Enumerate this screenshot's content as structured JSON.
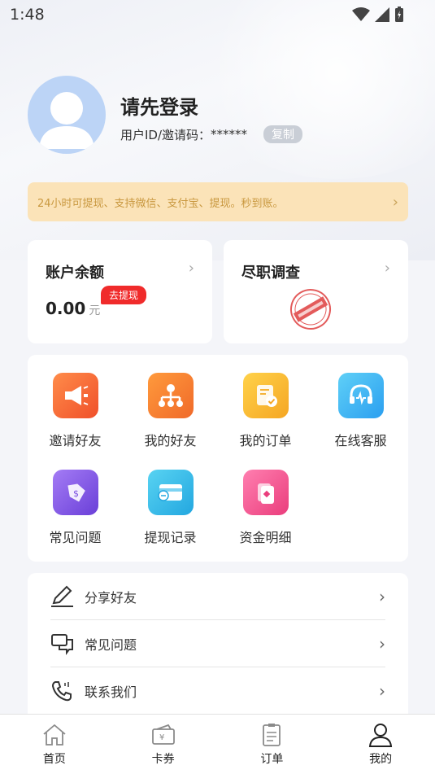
{
  "status_bar": {
    "time": "1:48"
  },
  "profile": {
    "title": "请先登录",
    "uid_label": "用户ID/邀请码：",
    "uid_value": "******",
    "copy_label": "复制"
  },
  "notice": {
    "text": "24小时可提现、支持微信、支付宝、提现。秒到账。"
  },
  "balance_card": {
    "title": "账户余额",
    "amount": "0.00",
    "unit": "元",
    "withdraw_label": "去提现"
  },
  "survey_card": {
    "title": "尽职调查"
  },
  "grid": {
    "items": [
      {
        "label": "邀请好友",
        "icon": "megaphone-icon",
        "color": "#f26b3d"
      },
      {
        "label": "我的好友",
        "icon": "network-icon",
        "color": "#f47b32"
      },
      {
        "label": "我的订单",
        "icon": "order-icon",
        "color": "#f8b72a"
      },
      {
        "label": "在线客服",
        "icon": "headset-icon",
        "color": "#3bb8ef"
      },
      {
        "label": "常见问题",
        "icon": "tag-icon",
        "color": "#8a5ce6"
      },
      {
        "label": "提现记录",
        "icon": "card-icon",
        "color": "#2fb8e6"
      },
      {
        "label": "资金明细",
        "icon": "wallet-icon",
        "color": "#f04d8a"
      }
    ]
  },
  "menu": {
    "items": [
      {
        "label": "分享好友",
        "icon": "pencil-icon"
      },
      {
        "label": "常见问题",
        "icon": "chat-icon"
      },
      {
        "label": "联系我们",
        "icon": "phone-icon"
      }
    ]
  },
  "tabbar": {
    "tabs": [
      {
        "label": "首页",
        "icon": "home-icon"
      },
      {
        "label": "卡券",
        "icon": "coupon-icon"
      },
      {
        "label": "订单",
        "icon": "order-list-icon"
      },
      {
        "label": "我的",
        "icon": "user-icon"
      }
    ],
    "active_index": 3
  }
}
